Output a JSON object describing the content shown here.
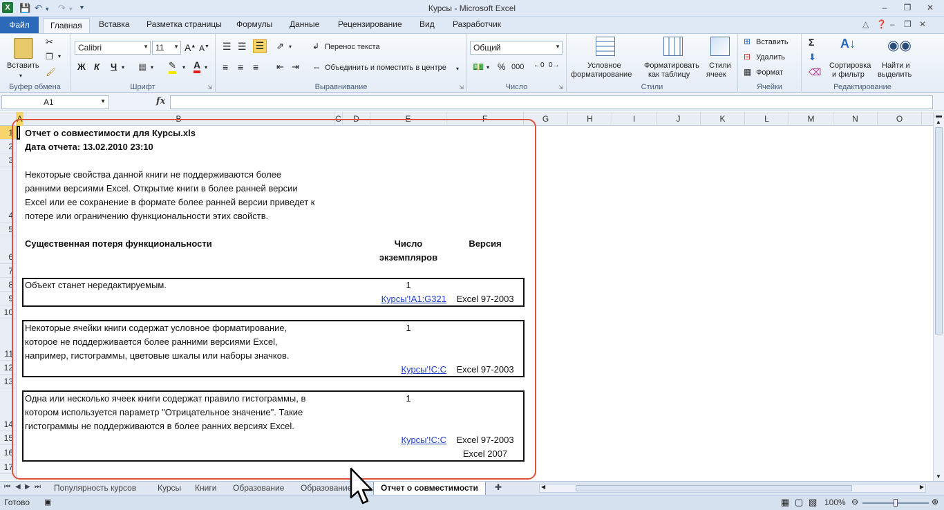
{
  "window": {
    "title": "Курсы - Microsoft Excel",
    "app_icon": "X"
  },
  "ribbon": {
    "tabs": [
      "Файл",
      "Главная",
      "Вставка",
      "Разметка страницы",
      "Формулы",
      "Данные",
      "Рецензирование",
      "Вид",
      "Разработчик"
    ],
    "active_tab": "Главная",
    "clipboard": {
      "paste": "Вставить",
      "label": "Буфер обмена"
    },
    "font": {
      "name": "Calibri",
      "size": "11",
      "bold": "Ж",
      "italic": "К",
      "underline": "Ч",
      "label": "Шрифт"
    },
    "alignment": {
      "wrap": "Перенос текста",
      "merge": "Объединить и поместить в центре",
      "label": "Выравнивание"
    },
    "number": {
      "format": "Общий",
      "percent": "%",
      "thousands": "000",
      "label": "Число"
    },
    "styles": {
      "conditional": [
        "Условное",
        "форматирование"
      ],
      "as_table": [
        "Форматировать",
        "как таблицу"
      ],
      "cell_styles": [
        "Стили",
        "ячеек"
      ],
      "label": "Стили"
    },
    "cells": {
      "insert": "Вставить",
      "delete": "Удалить",
      "format": "Формат",
      "label": "Ячейки"
    },
    "editing": {
      "sort": [
        "Сортировка",
        "и фильтр"
      ],
      "find": [
        "Найти и",
        "выделить"
      ],
      "label": "Редактирование"
    }
  },
  "formula_bar": {
    "name_box": "A1",
    "fx": "fx",
    "value": ""
  },
  "columns": [
    "A",
    "B",
    "C",
    "D",
    "E",
    "F",
    "G",
    "H",
    "I",
    "J",
    "K",
    "L",
    "M",
    "N",
    "O"
  ],
  "rows": [
    "1",
    "2",
    "3",
    "4",
    "5",
    "6",
    "7",
    "8",
    "9",
    "10",
    "11",
    "12",
    "13",
    "14",
    "15",
    "16",
    "17"
  ],
  "report": {
    "title": "Отчет о совместимости для Курсы.xls",
    "date": "Дата отчета: 13.02.2010 23:10",
    "intro": [
      "Некоторые свойства данной книги не поддерживаются более",
      "ранними версиями Excel. Открытие книги в более ранней версии",
      "Excel или ее сохранение в формате более ранней версии приведет к",
      "потере или ограничению функциональности этих свойств."
    ],
    "header_loss": "Существенная потеря функциональности",
    "header_count": [
      "Число",
      "экземпляров"
    ],
    "header_version": "Версия",
    "items": [
      {
        "text": [
          "Объект станет нередактируемым."
        ],
        "count": "1",
        "link": "Курсы'!A1:G321",
        "versions": [
          "Excel 97-2003"
        ]
      },
      {
        "text": [
          "Некоторые ячейки книги содержат условное форматирование,",
          "которое не поддерживается более ранними версиями Excel,",
          "например, гистограммы, цветовые шкалы или наборы значков."
        ],
        "count": "1",
        "link": "Курсы'!C:C",
        "versions": [
          "Excel 97-2003"
        ]
      },
      {
        "text": [
          "Одна или несколько ячеек книги содержат правило гистограммы, в",
          "котором используется параметр \"Отрицательное значение\". Такие",
          "гистограммы не поддерживаются в более ранних версиях Excel."
        ],
        "count": "1",
        "link": "Курсы'!C:C",
        "versions": [
          "Excel 97-2003",
          "Excel 2007"
        ]
      }
    ]
  },
  "sheets": [
    "Популярность курсов",
    "Курсы",
    "Книги",
    "Образование",
    "Образование",
    "Отчет о совместимости"
  ],
  "active_sheet": "Отчет о совместимости",
  "status": {
    "ready": "Готово",
    "zoom": "100%"
  },
  "colors": {
    "accent": "#2a6ab8",
    "highlight": "#e0533b",
    "link": "#1f3fbf"
  }
}
